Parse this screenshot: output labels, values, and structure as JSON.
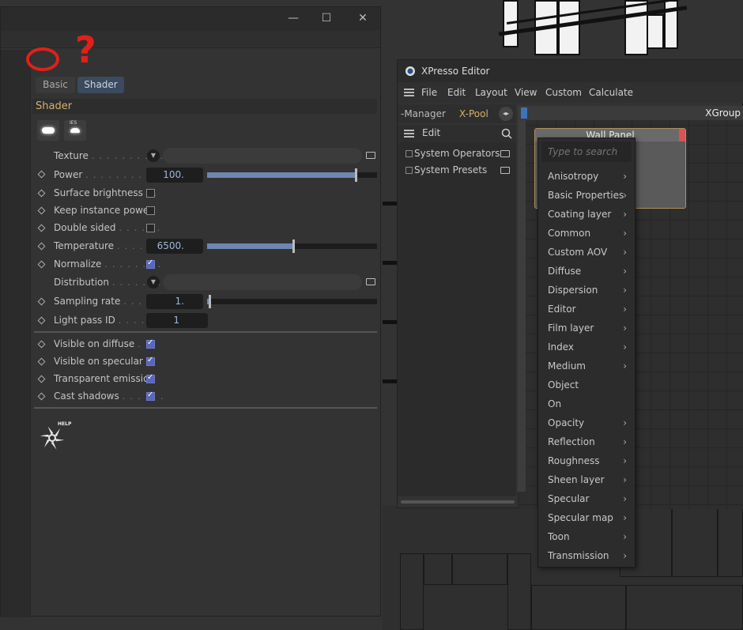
{
  "attribute_panel": {
    "tabs": [
      {
        "label": "Basic",
        "active": false
      },
      {
        "label": "Shader",
        "active": true
      }
    ],
    "section_title": "Shader",
    "thumb_ies_label": "IES",
    "rows": {
      "texture": {
        "label": "Texture"
      },
      "power": {
        "label": "Power",
        "value": "100.",
        "fraction": 0.87
      },
      "surface_brightness": {
        "label": "Surface brightness",
        "checked": false
      },
      "keep_instance_power": {
        "label": "Keep instance power",
        "checked": false
      },
      "double_sided": {
        "label": "Double sided",
        "checked": false
      },
      "temperature": {
        "label": "Temperature",
        "value": "6500.",
        "fraction": 0.5
      },
      "normalize": {
        "label": "Normalize",
        "checked": true
      },
      "distribution": {
        "label": "Distribution"
      },
      "sampling_rate": {
        "label": "Sampling rate",
        "value": "1.",
        "fraction": 0.01
      },
      "light_pass_id": {
        "label": "Light pass ID",
        "value": "1"
      },
      "visible_on_diffuse": {
        "label": "Visible on diffuse",
        "checked": true
      },
      "visible_on_specular": {
        "label": "Visible on specular",
        "checked": true
      },
      "transparent_emission": {
        "label": "Transparent emission",
        "checked": true
      },
      "cast_shadows": {
        "label": "Cast shadows",
        "checked": true
      }
    },
    "help_label": "HELP",
    "window_buttons": {
      "minimize": "—",
      "maximize": "☐",
      "close": "✕"
    }
  },
  "annotation": {
    "question_mark": "?"
  },
  "xpresso": {
    "title": "XPresso Editor",
    "menu": [
      "File",
      "Edit",
      "Layout",
      "View",
      "Custom",
      "Calculate"
    ],
    "tabs": [
      "-Manager",
      "X-Pool"
    ],
    "pool_menu_edit": "Edit",
    "tree": [
      "System Operators",
      "System Presets"
    ],
    "xgroup_label": "XGroup",
    "node_title": "Wall Panel"
  },
  "popup_menu": {
    "search_placeholder": "Type to search",
    "items": [
      {
        "label": "Anisotropy",
        "submenu": true
      },
      {
        "label": "Basic Properties",
        "submenu": true
      },
      {
        "label": "Coating layer",
        "submenu": true
      },
      {
        "label": "Common",
        "submenu": true
      },
      {
        "label": "Custom AOV",
        "submenu": true
      },
      {
        "label": "Diffuse",
        "submenu": true
      },
      {
        "label": "Dispersion",
        "submenu": true
      },
      {
        "label": "Editor",
        "submenu": true
      },
      {
        "label": "Film layer",
        "submenu": true
      },
      {
        "label": "Index",
        "submenu": true
      },
      {
        "label": "Medium",
        "submenu": true
      },
      {
        "label": "Object",
        "submenu": false
      },
      {
        "label": "On",
        "submenu": false
      },
      {
        "label": "Opacity",
        "submenu": true
      },
      {
        "label": "Reflection",
        "submenu": true
      },
      {
        "label": "Roughness",
        "submenu": true
      },
      {
        "label": "Sheen layer",
        "submenu": true
      },
      {
        "label": "Specular",
        "submenu": true
      },
      {
        "label": "Specular map",
        "submenu": true
      },
      {
        "label": "Toon",
        "submenu": true
      },
      {
        "label": "Transmission",
        "submenu": true
      }
    ]
  },
  "colors": {
    "accent_active_tab": "#3b4a5e",
    "annotation_red": "#e0201a",
    "section_title": "#d8b06a"
  }
}
